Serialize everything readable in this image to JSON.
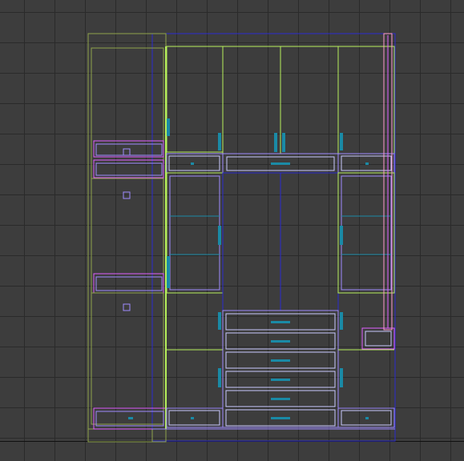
{
  "viewport": {
    "label": "",
    "background": "#3d3d3d",
    "grid_color": "#2a2a2a"
  },
  "scene": {
    "subject": "wardrobe-cabinet-wireframe",
    "colors": {
      "frame_blue": "#2c2ccf",
      "lime": "#b6f05a",
      "olive": "#8fa24a",
      "violet": "#a08cff",
      "magenta": "#e060ff",
      "pink": "#ff9ad0",
      "teal": "#1a8aa6",
      "light_line": "#c9c9ff"
    }
  }
}
